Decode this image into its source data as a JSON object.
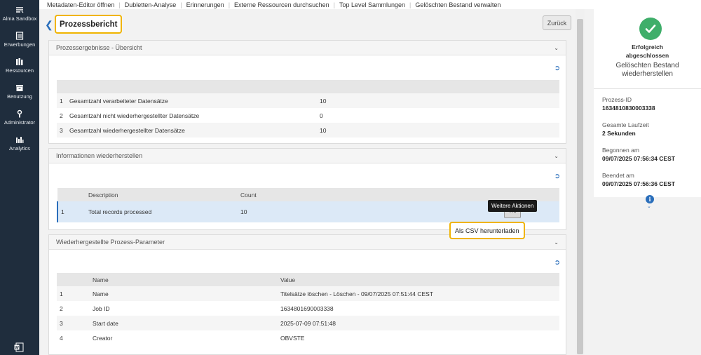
{
  "leftnav": {
    "items": [
      {
        "label": "Alma Sandbox",
        "icon": "sandbox-icon"
      },
      {
        "label": "Erwerbungen",
        "icon": "acquisitions-icon"
      },
      {
        "label": "Ressourcen",
        "icon": "resources-icon"
      },
      {
        "label": "Benutzung",
        "icon": "fulfillment-icon"
      },
      {
        "label": "Administrator",
        "icon": "admin-icon"
      },
      {
        "label": "Analytics",
        "icon": "analytics-icon"
      }
    ],
    "bottom_icon": "word-doc-icon"
  },
  "topbar": {
    "items": [
      "Metadaten-Editor öffnen",
      "Dubletten-Analyse",
      "Erinnerungen",
      "Externe Ressourcen durchsuchen",
      "Top Level Sammlungen",
      "Gelöschten Bestand verwalten"
    ]
  },
  "page": {
    "title": "Prozessbericht",
    "back_button": "Zurück"
  },
  "panel1": {
    "title": "Prozessergebnisse - Übersicht",
    "rows": [
      {
        "num": "1",
        "label": "Gesamtzahl verarbeiteter Datensätze",
        "value": "10"
      },
      {
        "num": "2",
        "label": "Gesamtzahl nicht wiederhergestellter Datensätze",
        "value": "0"
      },
      {
        "num": "3",
        "label": "Gesamtzahl wiederhergestellter Datensätze",
        "value": "10"
      }
    ]
  },
  "panel2": {
    "title": "Informationen wiederherstellen",
    "columns": [
      "Description",
      "Count"
    ],
    "rows": [
      {
        "num": "1",
        "description": "Total records processed",
        "count": "10"
      }
    ],
    "more_actions_tooltip": "Weitere Aktionen",
    "more_actions_btn": "···",
    "csv_menu_item": "Als CSV herunterladen"
  },
  "panel3": {
    "title": "Wiederhergestellte Prozess-Parameter",
    "columns": [
      "Name",
      "Value"
    ],
    "rows": [
      {
        "num": "1",
        "name": "Name",
        "value": "Titelsätze löschen - Löschen - 09/07/2025 07:51:44 CEST"
      },
      {
        "num": "2",
        "name": "Job ID",
        "value": "1634801690003338"
      },
      {
        "num": "3",
        "name": "Start date",
        "value": "2025-07-09 07:51:48"
      },
      {
        "num": "4",
        "name": "Creator",
        "value": "OBVSTE"
      }
    ]
  },
  "right": {
    "status_main": "Erfolgreich abgeschlossen",
    "status_job": "Gelöschten Bestand wiederherstellen",
    "fields": [
      {
        "key": "Prozess-ID",
        "value": "1634810830003338"
      },
      {
        "key": "Gesamte Laufzeit",
        "value": "2 Sekunden"
      },
      {
        "key": "Begonnen am",
        "value": "09/07/2025 07:56:34 CEST"
      },
      {
        "key": "Beendet am",
        "value": "09/07/2025 07:56:36 CEST"
      }
    ]
  },
  "colors": {
    "accent": "#2a6ebb",
    "highlight": "#f0b400",
    "success": "#3fae6a",
    "nav": "#1f2d3d"
  }
}
